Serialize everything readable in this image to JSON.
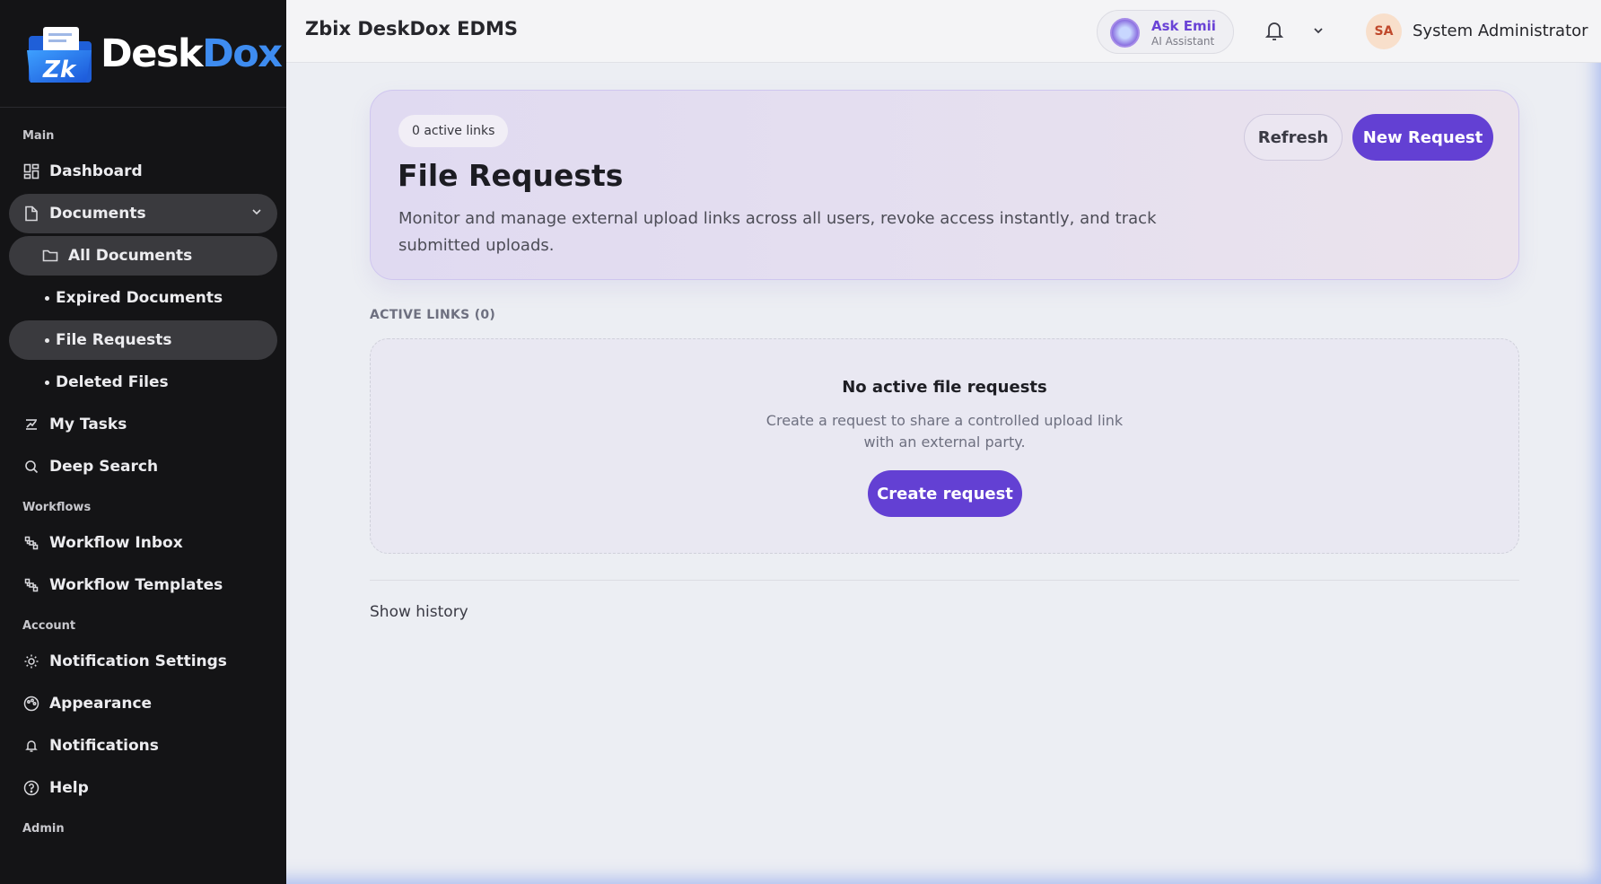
{
  "brand": {
    "logo_part1": "Desk",
    "logo_part2": "Dox",
    "accent": "#3e8cf0"
  },
  "sidebar": {
    "sections": {
      "main": "Main",
      "workflows": "Workflows",
      "account": "Account",
      "admin": "Admin"
    },
    "items": {
      "dashboard": "Dashboard",
      "documents": "Documents",
      "all_documents": "All Documents",
      "expired_documents": "Expired Documents",
      "file_requests": "File Requests",
      "deleted_files": "Deleted Files",
      "my_tasks": "My Tasks",
      "deep_search": "Deep Search",
      "workflow_inbox": "Workflow Inbox",
      "workflow_templates": "Workflow Templates",
      "notification_settings": "Notification Settings",
      "appearance": "Appearance",
      "notifications": "Notifications",
      "help": "Help"
    }
  },
  "topbar": {
    "title": "Zbix DeskDox EDMS",
    "assistant_name": "Ask Emii",
    "assistant_sub": "AI Assistant",
    "user_initials": "SA",
    "user_name": "System Administrator"
  },
  "hero": {
    "chip": "0 active links",
    "title": "File Requests",
    "description": "Monitor and manage external upload links across all users, revoke access instantly, and track submitted uploads.",
    "refresh_label": "Refresh",
    "new_request_label": "New Request"
  },
  "active_links": {
    "label": "ACTIVE LINKS (0)",
    "empty_title": "No active file requests",
    "empty_line1": "Create a request to share a controlled upload link",
    "empty_line2": "with an external party.",
    "create_label": "Create request"
  },
  "history_label": "Show history",
  "colors": {
    "primary": "#6340d3",
    "sidebar_bg": "#141416"
  }
}
